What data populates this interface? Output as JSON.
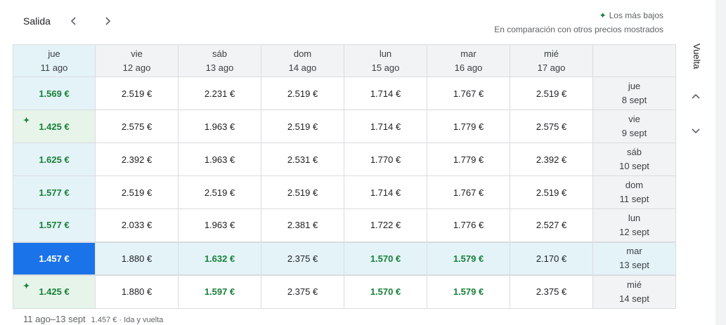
{
  "header": {
    "salida": "Salida"
  },
  "legend": {
    "title": "Los más bajos",
    "subtitle": "En comparación con otros precios mostrados",
    "sparkle": "✦"
  },
  "vuelta": "Vuelta",
  "columns": [
    {
      "day": "jue",
      "date": "11 ago"
    },
    {
      "day": "vie",
      "date": "12 ago"
    },
    {
      "day": "sáb",
      "date": "13 ago"
    },
    {
      "day": "dom",
      "date": "14 ago"
    },
    {
      "day": "lun",
      "date": "15 ago"
    },
    {
      "day": "mar",
      "date": "16 ago"
    },
    {
      "day": "mié",
      "date": "17 ago"
    }
  ],
  "rows": [
    {
      "day": "jue",
      "date": "8 sept",
      "prices": [
        "1.569 €",
        "2.519 €",
        "2.231 €",
        "2.519 €",
        "1.714 €",
        "1.767 €",
        "2.519 €"
      ]
    },
    {
      "day": "vie",
      "date": "9 sept",
      "prices": [
        "1.425 €",
        "2.575 €",
        "1.963 €",
        "2.519 €",
        "1.714 €",
        "1.779 €",
        "2.575 €"
      ]
    },
    {
      "day": "sáb",
      "date": "10 sept",
      "prices": [
        "1.625 €",
        "2.392 €",
        "1.963 €",
        "2.531 €",
        "1.770 €",
        "1.779 €",
        "2.392 €"
      ]
    },
    {
      "day": "dom",
      "date": "11 sept",
      "prices": [
        "1.577 €",
        "2.519 €",
        "2.519 €",
        "2.519 €",
        "1.714 €",
        "1.767 €",
        "2.519 €"
      ]
    },
    {
      "day": "lun",
      "date": "12 sept",
      "prices": [
        "1.577 €",
        "2.033 €",
        "1.963 €",
        "2.381 €",
        "1.722 €",
        "1.776 €",
        "2.527 €"
      ]
    },
    {
      "day": "mar",
      "date": "13 sept",
      "prices": [
        "1.457 €",
        "1.880 €",
        "1.632 €",
        "2.375 €",
        "1.570 €",
        "1.579 €",
        "2.170 €"
      ]
    },
    {
      "day": "mié",
      "date": "14 sept",
      "prices": [
        "1.425 €",
        "1.880 €",
        "1.597 €",
        "2.375 €",
        "1.570 €",
        "1.579 €",
        "2.375 €"
      ]
    }
  ],
  "footer": {
    "dates": "11 ago–13 sept",
    "summary": "1.457 € · Ida y vuelta"
  },
  "colors": {
    "accent": "#1a73e8",
    "green": "#188038",
    "highlight": "#e4f3f8",
    "lowest": "#e6f4ea"
  }
}
